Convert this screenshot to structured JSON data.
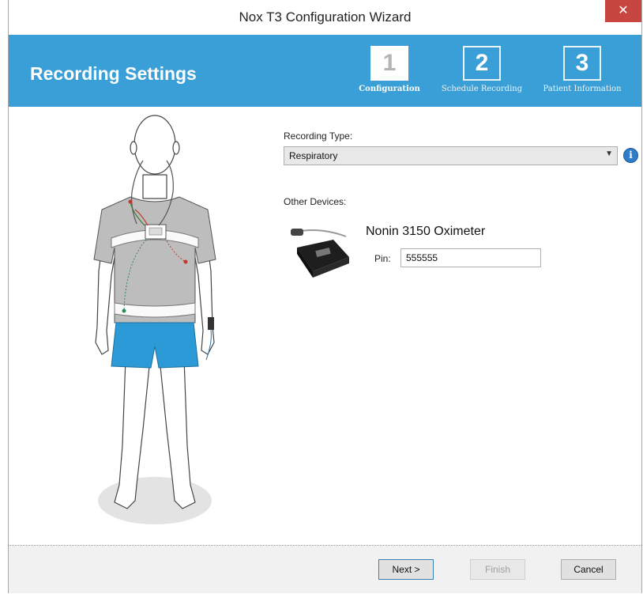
{
  "window": {
    "title": "Nox T3 Configuration Wizard",
    "close_glyph": "✕"
  },
  "header": {
    "title": "Recording Settings",
    "steps": [
      {
        "number": "1",
        "label": "Configuration",
        "active": true
      },
      {
        "number": "2",
        "label": "Schedule Recording",
        "active": false
      },
      {
        "number": "3",
        "label": "Patient Information",
        "active": false
      }
    ]
  },
  "form": {
    "recording_type_label": "Recording Type:",
    "recording_type_value": "Respiratory",
    "other_devices_label": "Other Devices:",
    "device": {
      "name": "Nonin 3150 Oximeter",
      "pin_label": "Pin:",
      "pin_value": "555555"
    }
  },
  "buttons": {
    "next": "Next >",
    "finish": "Finish",
    "cancel": "Cancel"
  },
  "colors": {
    "header_bg": "#3a9fd6",
    "close_bg": "#c7463f",
    "shorts": "#2b9ad6",
    "info": "#2f7dc9"
  }
}
